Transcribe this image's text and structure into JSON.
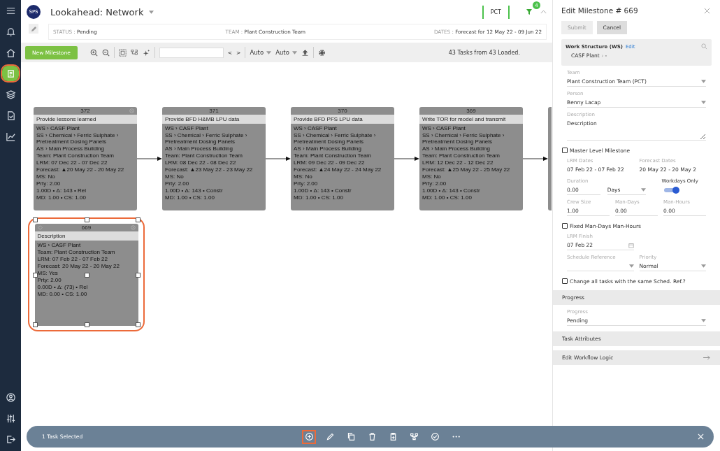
{
  "sidebar": {
    "items": [
      {
        "kind": "menu",
        "selected": false
      },
      {
        "kind": "bell",
        "selected": false
      },
      {
        "kind": "home",
        "selected": false
      },
      {
        "kind": "list",
        "selected": true
      },
      {
        "kind": "layers",
        "selected": false
      },
      {
        "kind": "doc",
        "selected": false
      },
      {
        "kind": "chart",
        "selected": false
      }
    ],
    "bottom_items": [
      {
        "kind": "user",
        "selected": false
      },
      {
        "kind": "sliders",
        "selected": false
      },
      {
        "kind": "logout",
        "selected": false
      }
    ]
  },
  "header": {
    "logo": "SPS",
    "title": "Lookahead: Network",
    "status_label": "STATUS :",
    "status": "Pending",
    "team_label": "TEAM :",
    "team": "Plant Construction Team",
    "dates_label": "DATES :",
    "dates": "Forecast for 12 May 22 - 09 Jun 22",
    "team_code": "PCT",
    "filter_count": "4"
  },
  "toolbar": {
    "new_button": "New Milestone",
    "nav_prev": "<",
    "nav_next": ">",
    "dropdowns": [
      "Auto",
      "Auto"
    ],
    "summary": "43 Tasks from 43 Loaded."
  },
  "network": {
    "cards": [
      {
        "id": "372",
        "title": "Provide lessons learned",
        "closable": true,
        "lines": [
          "WS › CASF Plant",
          "SS › Chemical › Ferric Sulphate › Pretreatment Dosing Panels",
          "AS › Main Process Building",
          "Team: Plant Construction Team",
          "LRM: 07 Dec 22 - 07 Dec 22",
          "Forecast: ▲20 May 22 - 20 May 22",
          "MS: No",
          "Prty: 2.00",
          "1.00D • Δ: 143 • Rel",
          "MD: 1.00 • CS: 1.00"
        ]
      },
      {
        "id": "371",
        "title": "Provide BFD H&MB LPU data",
        "closable": false,
        "lines": [
          "WS › CASF Plant",
          "SS › Chemical › Ferric Sulphate › Pretreatment Dosing Panels",
          "AS › Main Process Building",
          "Team: Plant Construction Team",
          "LRM: 08 Dec 22 - 08 Dec 22",
          "Forecast: ▲23 May 22 - 23 May 22",
          "MS: No",
          "Prty: 2.00",
          "1.00D • Δ: 143 • Constr",
          "MD: 1.00 • CS: 1.00"
        ]
      },
      {
        "id": "370",
        "title": "Provide BFD PFS LPU data",
        "closable": false,
        "lines": [
          "WS › CASF Plant",
          "SS › Chemical › Ferric Sulphate › Pretreatment Dosing Panels",
          "AS › Main Process Building",
          "Team: Plant Construction Team",
          "LRM: 09 Dec 22 - 09 Dec 22",
          "Forecast: ▲24 May 22 - 24 May 22",
          "MS: No",
          "Prty: 2.00",
          "1.00D • Δ: 143 • Constr",
          "MD: 1.00 • CS: 1.00"
        ]
      },
      {
        "id": "369",
        "title": "Write TOR for model and transmit",
        "closable": false,
        "lines": [
          "WS › CASF Plant",
          "SS › Chemical › Ferric Sulphate › Pretreatment Dosing Panels",
          "AS › Main Process Building",
          "Team: Plant Construction Team",
          "LRM: 12 Dec 22 - 12 Dec 22",
          "Forecast: ▲25 May 22 - 25 May 22",
          "MS: No",
          "Prty: 2.00",
          "1.00D • Δ: 143 • Constr",
          "MD: 1.00 • CS: 1.00"
        ]
      }
    ],
    "selected_card": {
      "id": "669",
      "title": "Description",
      "closable": true,
      "lines": [
        "WS › CASF Plant",
        "Team: Plant Construction Team",
        "LRM: 07 Feb 22 - 07 Feb 22",
        "Forecast: 20 May 22 - 20 May 22",
        "MS: Yes",
        "Prty: 2.00",
        "0.00D • Δ: (73) • Rel",
        "MD: 0.00 • CS: 1.00"
      ]
    }
  },
  "panel": {
    "title": "Edit Milestone # 669",
    "submit": {
      "label": "Submit",
      "disabled": true
    },
    "cancel": "Cancel",
    "ws": {
      "label": "Work Structure (WS)",
      "edit": "Edit",
      "path": "CASF Plant",
      "sep": "›",
      "rest": "-"
    },
    "team": {
      "label": "Team",
      "value": "Plant Construction Team (PCT)"
    },
    "person": {
      "label": "Person",
      "value": "Benny Lacap"
    },
    "description": {
      "label": "Description",
      "value": "Description"
    },
    "master_level": {
      "label": "Master Level Milestone",
      "checked": false
    },
    "lrm_dates": {
      "label": "LRM Dates",
      "value": "07 Feb 22 - 07 Feb 22"
    },
    "forecast_dates": {
      "label": "Forecast Dates",
      "value": "20 May 22 - 20 May 2"
    },
    "duration": {
      "label": "Duration",
      "value": "0.00",
      "unit": "Days"
    },
    "workdays_only": {
      "label": "Workdays Only",
      "on": true
    },
    "crew_size": {
      "label": "Crew Size",
      "value": "1.00"
    },
    "man_days": {
      "label": "Man-Days",
      "value": "0.00"
    },
    "man_hours": {
      "label": "Man-Hours",
      "value": "0.00"
    },
    "fixed": {
      "label": "Fixed Man-Days Man-Hours",
      "checked": false
    },
    "lrm_finish": {
      "label": "LRM Finish",
      "value": "07 Feb 22"
    },
    "schedule_reference": {
      "label": "Schedule Reference"
    },
    "priority": {
      "label": "Priority",
      "value": "Normal"
    },
    "change_all": {
      "label": "Change all tasks with the same Sched. Ref.?",
      "checked": false
    },
    "progress_section": "Progress",
    "progress": {
      "label": "Progress",
      "value": "Pending"
    },
    "task_attributes": "Task Attributes",
    "workflow": "Edit Workflow Logic"
  },
  "selection_bar": {
    "text": "1 Task Selected",
    "actions": [
      {
        "kind": "add",
        "selected": true
      },
      {
        "kind": "edit",
        "selected": false
      },
      {
        "kind": "copy",
        "selected": false
      },
      {
        "kind": "delete",
        "selected": false
      },
      {
        "kind": "paste",
        "selected": false
      },
      {
        "kind": "network",
        "selected": false
      },
      {
        "kind": "check",
        "selected": false
      },
      {
        "kind": "more",
        "selected": false
      }
    ]
  }
}
